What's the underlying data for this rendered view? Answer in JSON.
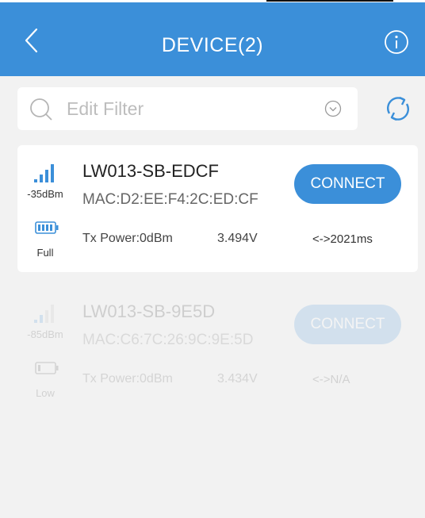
{
  "header": {
    "title": "DEVICE(2)",
    "back_icon": "back-chevron-icon",
    "info_icon": "info-icon"
  },
  "filter": {
    "placeholder": "Edit Filter",
    "search_icon": "search-icon",
    "dropdown_icon": "chevron-down-circle-icon",
    "refresh_icon": "refresh-icon"
  },
  "colors": {
    "accent": "#3b8fd9",
    "background": "#f2f2f2",
    "card": "#ffffff"
  },
  "devices": [
    {
      "name": "LW013-SB-EDCF",
      "mac": "MAC:D2:EE:F4:2C:ED:CF",
      "rssi": "-35dBm",
      "battery_label": "Full",
      "battery_level": 1.0,
      "signal_bars": 4,
      "tx_power": "Tx Power:0dBm",
      "voltage": "3.494V",
      "interval": "<->2021ms",
      "connect_label": "CONNECT",
      "active": true
    },
    {
      "name": "LW013-SB-9E5D",
      "mac": "MAC:C6:7C:26:9C:9E:5D",
      "rssi": "-85dBm",
      "battery_label": "Low",
      "battery_level": 0.2,
      "signal_bars": 2,
      "tx_power": "Tx Power:0dBm",
      "voltage": "3.434V",
      "interval": "<->N/A",
      "connect_label": "CONNECT",
      "active": false
    }
  ]
}
